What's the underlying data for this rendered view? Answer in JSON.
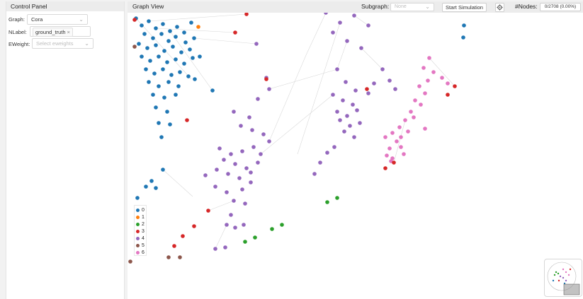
{
  "control_panel": {
    "title": "Control Panel",
    "graph_label": "Graph:",
    "graph_value": "Cora",
    "nlabel_label": "NLabel:",
    "nlabel_tag": "ground_truth",
    "nlabel_tag_close": "×",
    "eweight_label": "EWeight:",
    "eweight_placeholder": "Select eweights"
  },
  "graph_view": {
    "title": "Graph View",
    "subgraph_label": "Subgraph:",
    "subgraph_placeholder": "None",
    "start_button": "Start Simulation",
    "settings_icon": "gear-icon",
    "nodes_label": "#Nodes:",
    "nodes_value": "0/2708 (0.00%)"
  },
  "legend": [
    {
      "label": "0",
      "color": "#1f77b4"
    },
    {
      "label": "1",
      "color": "#ff7f0e"
    },
    {
      "label": "2",
      "color": "#2ca02c"
    },
    {
      "label": "3",
      "color": "#d62728"
    },
    {
      "label": "4",
      "color": "#9467bd"
    },
    {
      "label": "5",
      "color": "#8c564b"
    },
    {
      "label": "6",
      "color": "#e377c2"
    }
  ],
  "icons": {
    "chevron": "chevron-down-icon",
    "settings": "gear-icon",
    "minimap": "minimap-icon"
  }
}
